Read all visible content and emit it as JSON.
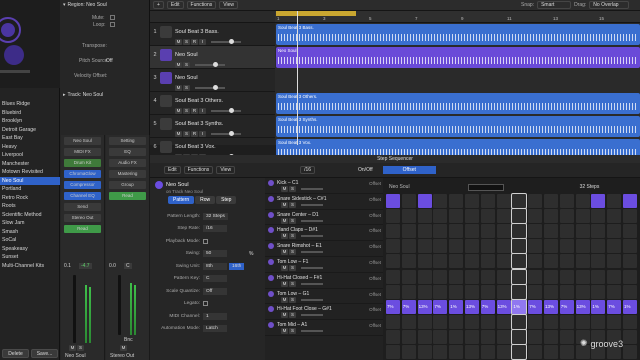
{
  "library": {
    "items": [
      "Blues Ridge",
      "Bluebird",
      "Brooklyn",
      "Detroit Garage",
      "East Bay",
      "Heavy",
      "Liverpool",
      "Manchester",
      "Motown Revisited",
      "Neo Soul",
      "Portland",
      "Retro Rock",
      "Roots",
      "Scientific Method",
      "Slow Jam",
      "Smash",
      "SoCal",
      "Speakeasy",
      "Sunset",
      "Multi-Channel Kits"
    ],
    "selected": "Neo Soul",
    "delete_label": "Delete",
    "save_label": "Save..."
  },
  "inspector": {
    "region_label": "Region: Neo Soul",
    "mute": "Mute:",
    "loop": "Loop:",
    "transpose": "Transpose:",
    "pitch_source": "Pitch Source:",
    "pitch_source_val": "Off",
    "velocity_offset": "Velocity Offset:",
    "track_label": "Track: Neo Soul",
    "strip1": {
      "name": "Neo Soul",
      "slots": [
        "Neo Soul",
        "MIDI FX",
        "Drum Kit",
        "ChromaGlow",
        "Compressor",
        "Channel EQ",
        "Send",
        "Stereo Out",
        "Read"
      ],
      "pan": "0.1",
      "vol": "-4.7",
      "ms": [
        "M",
        "S"
      ]
    },
    "strip2": {
      "name": "Stereo Out",
      "slots": [
        "Setting",
        "EQ",
        "Audio FX",
        "Mastering",
        "Group",
        "Read"
      ],
      "pan": "0.0",
      "vol": "C",
      "ms": [
        "M"
      ],
      "bnc": "Bnc"
    }
  },
  "toolbar": {
    "edit": "Edit",
    "functions": "Functions",
    "view": "View",
    "snap_label": "Snap:",
    "snap_val": "Smart",
    "drag_label": "Drag:",
    "drag_val": "No Overlap"
  },
  "ruler": [
    "1",
    "3",
    "5",
    "7",
    "9",
    "11",
    "13",
    "15"
  ],
  "tracks": [
    {
      "num": "1",
      "name": "Soul Beat 3 Bass.",
      "ms": [
        "M",
        "S",
        "R",
        "I"
      ],
      "region": "Soul Beat 3 Bass."
    },
    {
      "num": "2",
      "name": "Neo Soul",
      "ms": [
        "M",
        "S"
      ],
      "region": "Neo Soul"
    },
    {
      "num": "3",
      "name": "Neo Soul",
      "ms": [
        "M",
        "S"
      ],
      "region": ""
    },
    {
      "num": "4",
      "name": "Soul Beat 3 Others.",
      "ms": [
        "M",
        "S",
        "R",
        "I"
      ],
      "region": "Soul Beat 3 Others."
    },
    {
      "num": "5",
      "name": "Soul Beat 3 Synths.",
      "ms": [
        "M",
        "S",
        "R",
        "I"
      ],
      "region": "Soul Beat 3 Synths."
    },
    {
      "num": "6",
      "name": "Soul Beat 3 Vox.",
      "ms": [
        "M",
        "S",
        "R",
        "I"
      ],
      "region": "Soul Beat 3 Vox."
    }
  ],
  "sequencer": {
    "title": "Step Sequencer",
    "edit": "Edit",
    "functions": "Functions",
    "view": "View",
    "track_name": "Neo Soul",
    "track_sub": "on Track Neo Soul",
    "tabs": [
      "Pattern",
      "Row",
      "Step"
    ],
    "onoff": "On/Off",
    "offset": "Offset",
    "rate": "/16",
    "region_name": "Neo Soul",
    "steps_val": "32 Steps",
    "params": [
      {
        "label": "Pattern Length:",
        "value": "32 Steps"
      },
      {
        "label": "Step Rate:",
        "value": "/16"
      },
      {
        "label": "Playback Mode:",
        "value": ""
      },
      {
        "label": "Swing:",
        "value": "50"
      },
      {
        "label": "Swing Unit:",
        "value": "8th"
      },
      {
        "label": "Pattern Key:",
        "value": "C"
      },
      {
        "label": "Scale Quantize:",
        "value": "Off"
      },
      {
        "label": "Legato:",
        "value": ""
      },
      {
        "label": "MIDI Channel:",
        "value": "1"
      },
      {
        "label": "Automation Mode:",
        "value": "Latch"
      }
    ],
    "swing_pct": "%",
    "swing_16": "16th",
    "rows": [
      {
        "name": "Kick – C1",
        "field": "Offset"
      },
      {
        "name": "Snare Sidestick – C#1",
        "field": "Offset"
      },
      {
        "name": "Snare Center – D1",
        "field": "Offset"
      },
      {
        "name": "Hand Claps – D#1",
        "field": "Offset"
      },
      {
        "name": "Snare Rimshot – E1",
        "field": "Offset"
      },
      {
        "name": "Tom Low – F1",
        "field": "Offset"
      },
      {
        "name": "Hi-Hat Closed – F#1",
        "field": "Offset"
      },
      {
        "name": "Tom Low – G1",
        "field": "Offset"
      },
      {
        "name": "Hi-Hat Foot Close – G#1",
        "field": "Offset"
      },
      {
        "name": "Tom Mid – A1",
        "field": "Offset"
      }
    ],
    "row_ms": [
      "M",
      "S"
    ],
    "hihat_values": [
      "7%",
      "7%",
      "13%",
      "7%",
      "1%",
      "13%",
      "7%",
      "13%",
      "1%",
      "7%",
      "13%",
      "7%",
      "13%",
      "1%",
      "7%",
      "1%"
    ]
  },
  "watermark": "groove3",
  "colors": {
    "accent": "#2f62c9",
    "region": "#3a6fd0",
    "midi": "#6b4de0",
    "playhead": "#e6c23a"
  }
}
